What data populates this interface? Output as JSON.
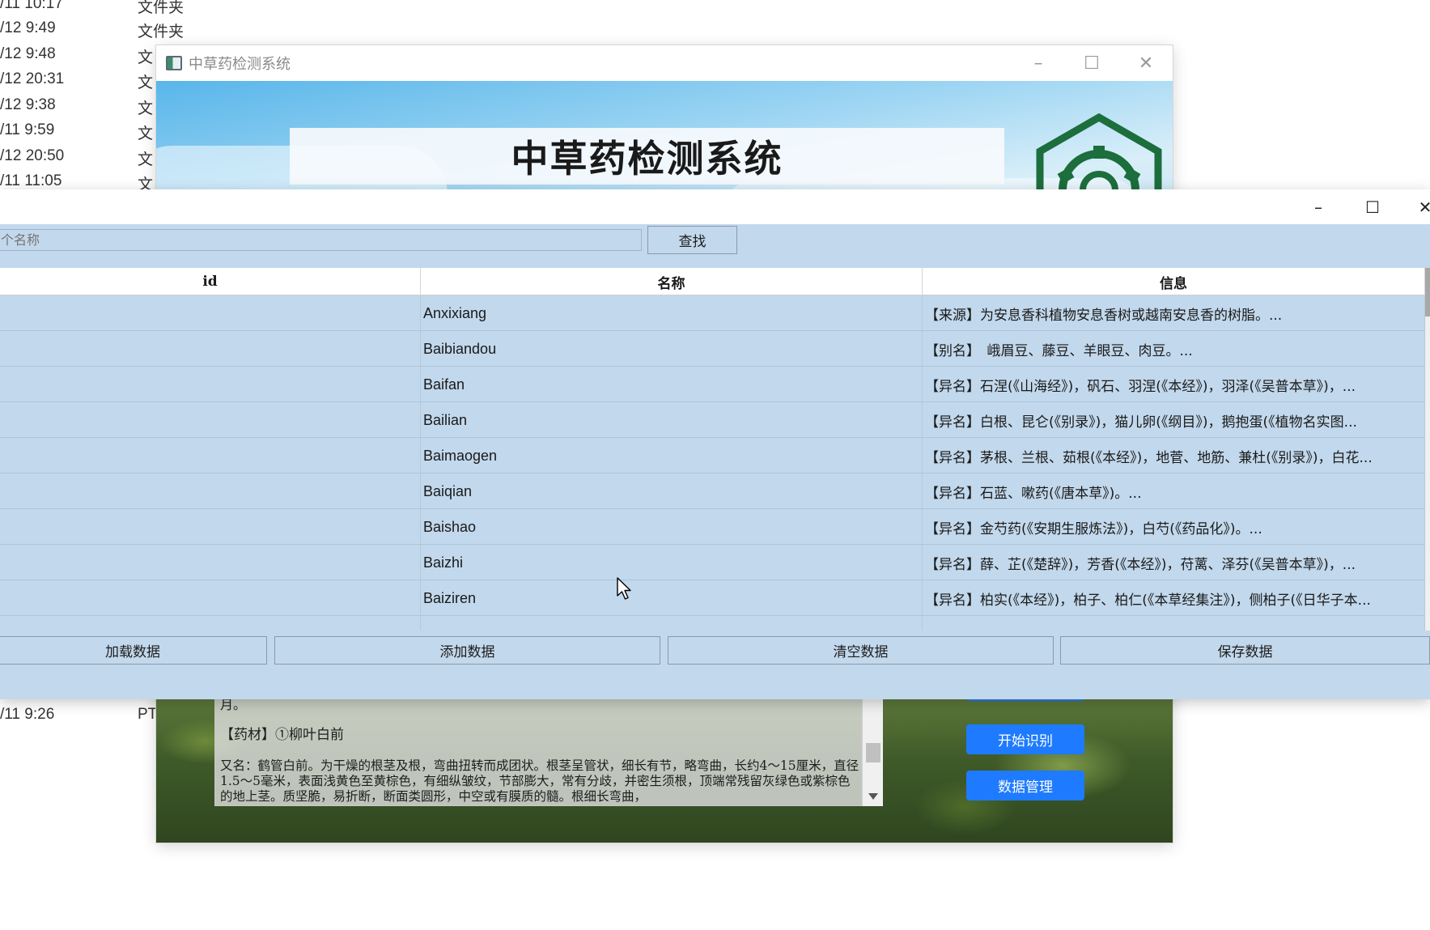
{
  "explorer": {
    "rows": [
      {
        "time": "/11 10:17",
        "kind": "文件夹"
      },
      {
        "time": "/12 9:49",
        "kind": "文件夹"
      },
      {
        "time": "/12 9:48",
        "kind": "文"
      },
      {
        "time": "/12 20:31",
        "kind": "文"
      },
      {
        "time": "/12 9:38",
        "kind": "文"
      },
      {
        "time": "/11 9:59",
        "kind": "文"
      },
      {
        "time": "/12 20:50",
        "kind": "文"
      },
      {
        "time": "/11 11:05",
        "kind": "文"
      }
    ],
    "lower_row": {
      "time": "/11 9:26",
      "kind": "PT"
    }
  },
  "main_window": {
    "title": "中草药检测系统",
    "banner_title": "中草药检测系统",
    "info_text": {
      "line1": "月。",
      "line2": "【药材】①柳叶白前",
      "line3": "又名：鹤管白前。为干燥的根茎及根，弯曲扭转而成团状。根茎呈管状，细长有节，略弯曲，长约4～15厘米，直径1.5～5毫米，表面浅黄色至黄棕色，有细纵皱纹，节部膨大，常有分歧，并密生须根，顶端常残留灰绿色或紫棕色的地上茎。质坚脆，易折断，断面类圆形，中空或有膜质的髓。根细长弯曲，"
    },
    "buttons": {
      "start_recognition": "开始识别",
      "data_management": "数据管理"
    }
  },
  "data_window": {
    "search": {
      "placeholder": "个名称",
      "button": "查找"
    },
    "columns": [
      "id",
      "名称",
      "信息"
    ],
    "rows": [
      {
        "id": "",
        "name": "Anxixiang",
        "info": "【来源】为安息香科植物安息香树或越南安息香的树脂。..."
      },
      {
        "id": "",
        "name": "Baibiandou",
        "info": "【别名】　峨眉豆、藤豆、羊眼豆、肉豆。..."
      },
      {
        "id": "",
        "name": "Baifan",
        "info": "【异名】石涅(《山海经》)，矾石、羽涅(《本经》)，羽泽(《吴普本草》)，..."
      },
      {
        "id": "",
        "name": "Bailian",
        "info": "【异名】白根、昆仑(《别录》)，猫儿卵(《纲目》)，鹅抱蛋(《植物名实图..."
      },
      {
        "id": "",
        "name": "Baimaogen",
        "info": "【异名】茅根、兰根、茹根(《本经》)，地菅、地筋、兼杜(《别录》)，白花..."
      },
      {
        "id": "",
        "name": "Baiqian",
        "info": "【异名】石蓝、嗽药(《唐本草》)。..."
      },
      {
        "id": "",
        "name": "Baishao",
        "info": "【异名】金芍药(《安期生服炼法》)，白芍(《药品化》)。..."
      },
      {
        "id": "",
        "name": "Baizhi",
        "info": "【异名】薛、芷(《楚辞》)，芳香(《本经》)，苻蓠、泽芬(《吴普本草》)，..."
      },
      {
        "id": "",
        "name": "Baiziren",
        "info": "【异名】柏实(《本经》)，柏子、柏仁(《本草经集注》)，侧柏子(《日华子本..."
      }
    ],
    "buttons": {
      "load": "加载数据",
      "add": "添加数据",
      "clear": "清空数据",
      "save": "保存数据"
    }
  }
}
